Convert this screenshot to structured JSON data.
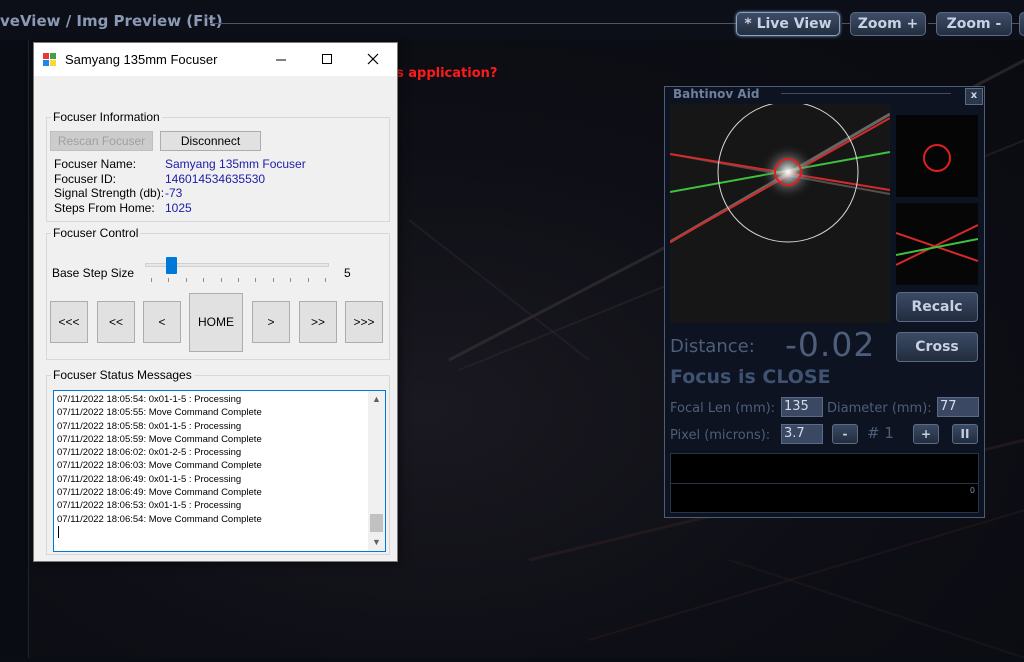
{
  "viewer": {
    "title": "veView / Img Preview (Fit)",
    "buttons": {
      "live_view": "* Live View",
      "zoom_in": "Zoom +",
      "zoom_out": "Zoom -"
    },
    "background_prompt": "s application?"
  },
  "dialog": {
    "title": "Samyang 135mm Focuser",
    "info": {
      "legend": "Focuser Information",
      "rescan_label": "Rescan Focuser",
      "disconnect_label": "Disconnect",
      "fields": [
        {
          "label": "Focuser Name:",
          "value": "Samyang 135mm Focuser"
        },
        {
          "label": "Focuser ID:",
          "value": "146014534635530"
        },
        {
          "label": "Signal Strength (db):",
          "value": "-73"
        },
        {
          "label": "Steps From Home:",
          "value": "1025"
        }
      ]
    },
    "control": {
      "legend": "Focuser Control",
      "step_label": "Base Step Size",
      "step_value": "5",
      "slider_fraction": 0.25,
      "buttons": [
        "<<<",
        "<<",
        "<",
        "HOME",
        ">",
        ">>",
        ">>>"
      ]
    },
    "status": {
      "legend": "Focuser Status Messages",
      "lines": [
        "07/11/2022 18:05:54: 0x01-1-5 : Processing",
        "07/11/2022 18:05:55: Move Command Complete",
        "07/11/2022 18:05:58: 0x01-1-5 : Processing",
        "07/11/2022 18:05:59: Move Command Complete",
        "07/11/2022 18:06:02: 0x01-2-5 : Processing",
        "07/11/2022 18:06:03: Move Command Complete",
        "07/11/2022 18:06:49: 0x01-1-5 : Processing",
        "07/11/2022 18:06:49: Move Command Complete",
        "07/11/2022 18:06:53: 0x01-1-5 : Processing",
        "07/11/2022 18:06:54: Move Command Complete"
      ]
    }
  },
  "bahtinov": {
    "title": "Bahtinov Aid",
    "close_label": "x",
    "recalc_label": "Recalc",
    "cross_label": "Cross",
    "distance_label": "Distance:",
    "distance_value": "-0.02",
    "focus_status": "Focus is CLOSE",
    "focal_len_label": "Focal Len (mm):",
    "focal_len_value": "135",
    "diameter_label": "Diameter (mm):",
    "diameter_value": "77",
    "pixel_label": "Pixel (microns):",
    "pixel_value": "3.7",
    "minus_label": "-",
    "index_label": "# 1",
    "plus_label": "+",
    "pause_label": "II",
    "graph_zero": "0",
    "colors": {
      "spike_red": "#d42a2a",
      "spike_green": "#3ec23e",
      "accent": "#4e5e7a"
    }
  }
}
